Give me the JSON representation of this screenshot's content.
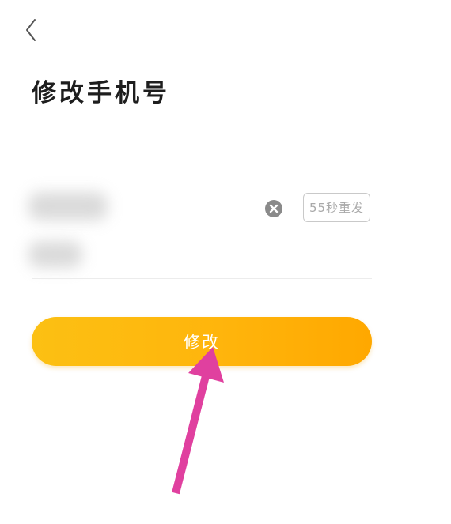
{
  "header": {
    "back_icon": "chevron-left-icon",
    "title": "修改手机号"
  },
  "form": {
    "phone_value": "",
    "code_value": "",
    "clear_icon": "clear-circle-icon",
    "resend_label": "55秒重发"
  },
  "actions": {
    "submit_label": "修改"
  },
  "colors": {
    "accent_start": "#fcc013",
    "accent_end": "#ffa800",
    "annotation_arrow": "#e0409f"
  }
}
